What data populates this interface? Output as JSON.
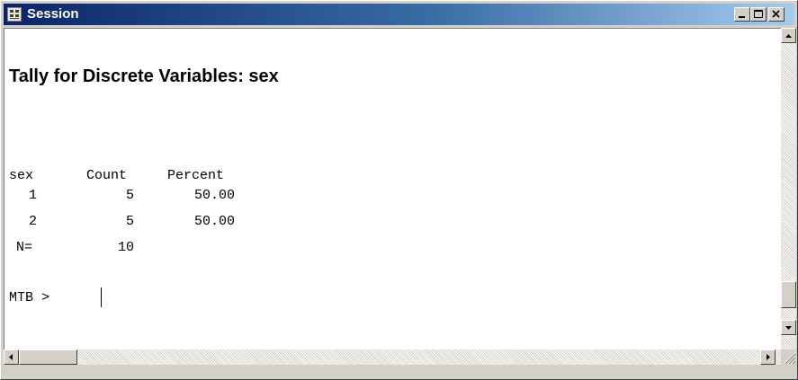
{
  "window": {
    "title": "Session",
    "icon": "session-window-icon",
    "controls": [
      "minimize-icon",
      "maximize-icon",
      "close-icon"
    ]
  },
  "session": {
    "heading": "Tally for Discrete Variables: sex",
    "table": {
      "headers": [
        "sex",
        "Count",
        "Percent"
      ],
      "rows": [
        [
          "1",
          "5",
          "50.00"
        ],
        [
          "2",
          "5",
          "50.00"
        ]
      ],
      "total_label": "N=",
      "total_value": "10"
    },
    "prompt": "MTB >"
  },
  "colors": {
    "titlebar_start": "#0a246a",
    "titlebar_end": "#a6caf0",
    "chrome": "#d4d0c8"
  }
}
